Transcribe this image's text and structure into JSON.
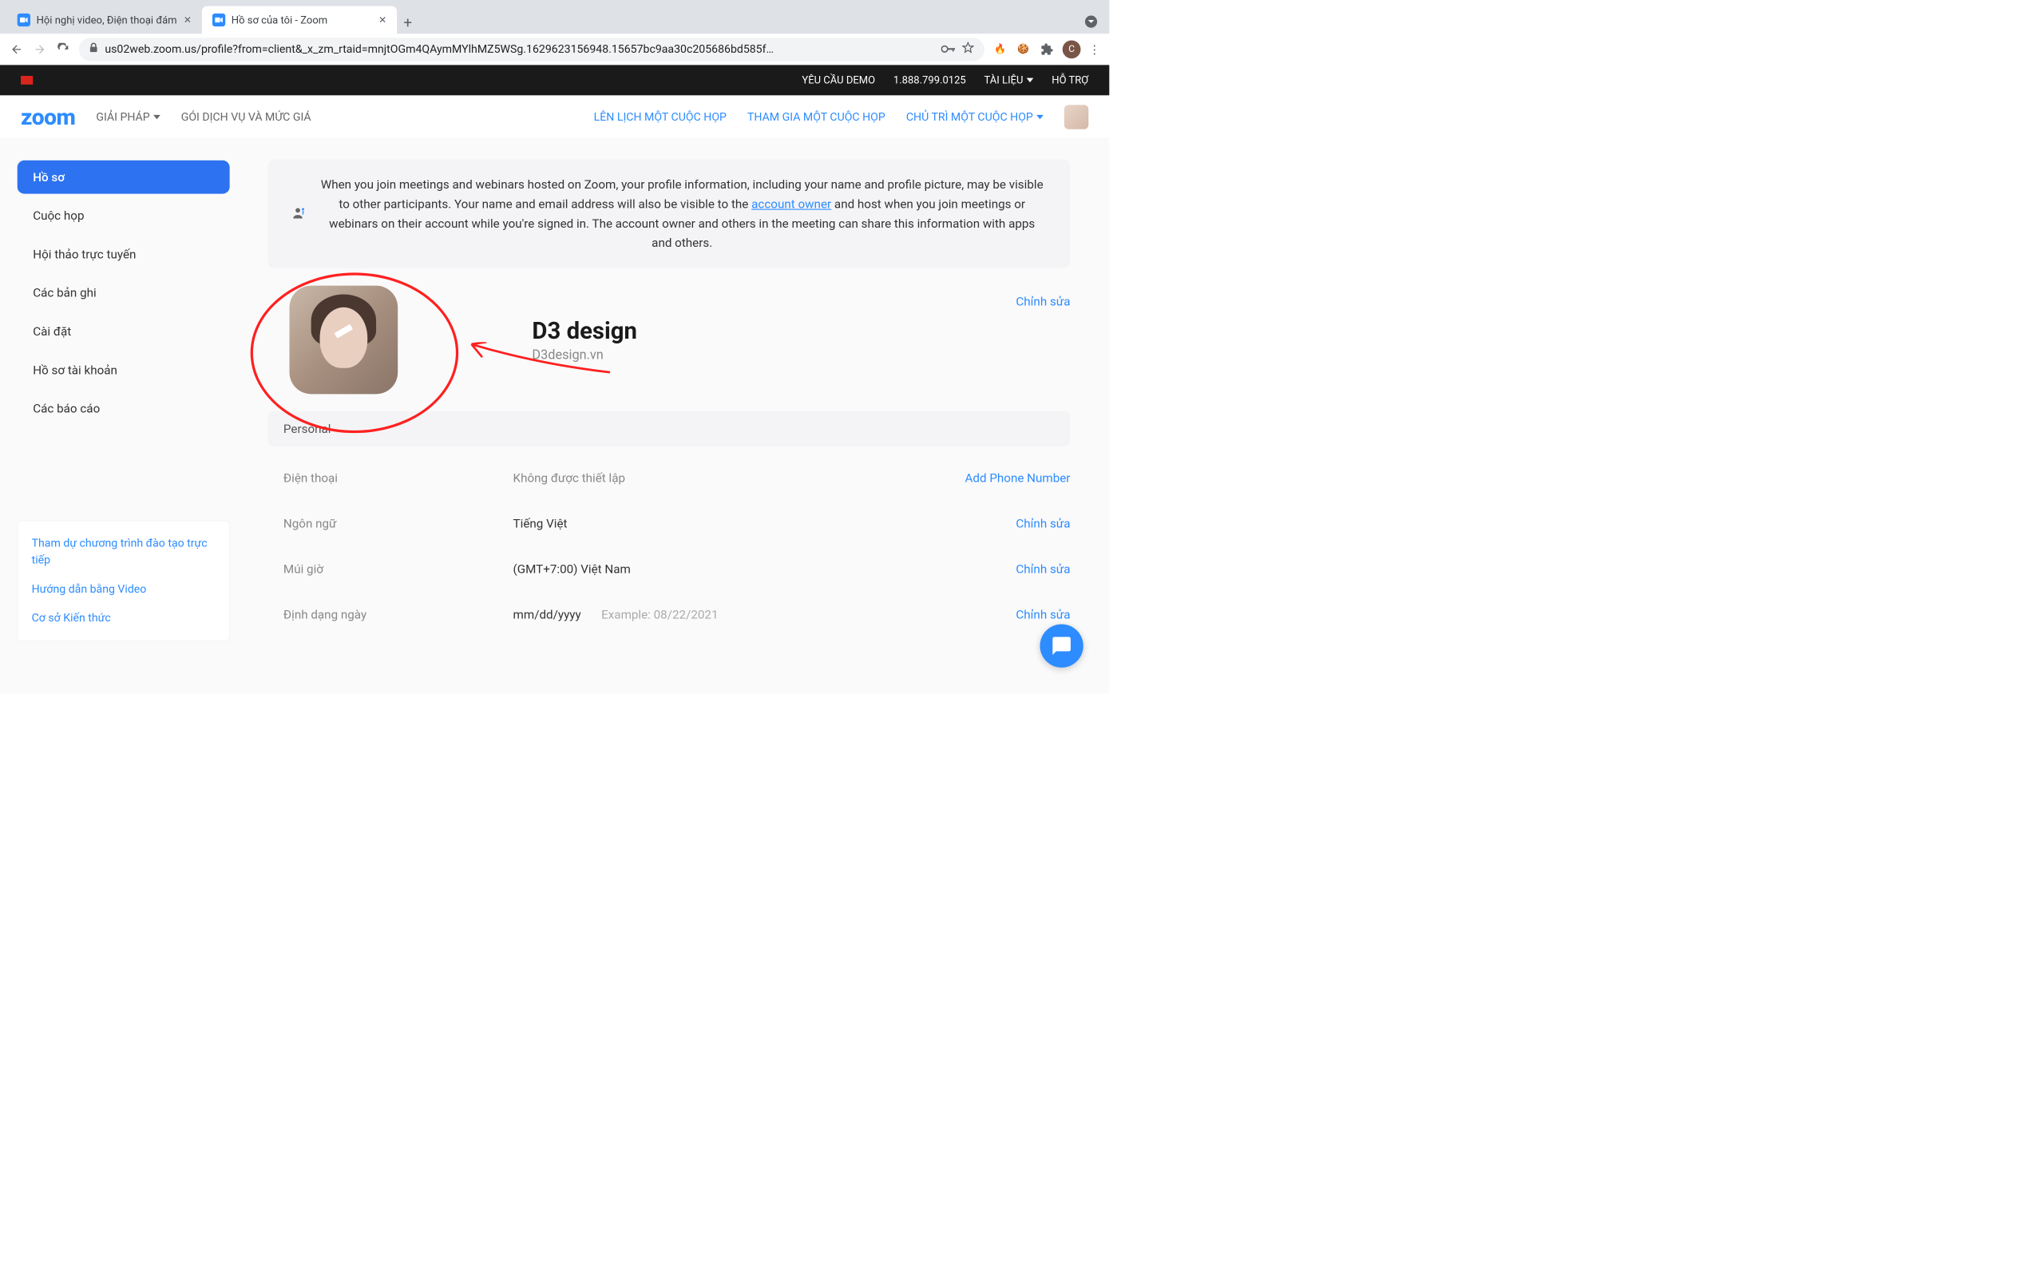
{
  "browser": {
    "tabs": [
      {
        "title": "Hội nghị video, Điện thoại đám"
      },
      {
        "title": "Hồ sơ của tôi - Zoom"
      }
    ],
    "url": "us02web.zoom.us/profile?from=client&_x_zm_rtaid=mnjtOGm4QAymMYlhMZ5WSg.1629623156948.15657bc9aa30c205686bd585f…",
    "avatar_letter": "C"
  },
  "topbar": {
    "demo": "YÊU CẦU DEMO",
    "phone": "1.888.799.0125",
    "resources": "TÀI LIỆU",
    "support": "HỖ TRỢ"
  },
  "header": {
    "logo": "zoom",
    "solutions": "GIẢI PHÁP",
    "plans": "GÓI DỊCH VỤ VÀ MỨC GIÁ",
    "schedule": "LÊN LỊCH MỘT CUỘC HỌP",
    "join": "THAM GIA MỘT CUỘC HỌP",
    "host": "CHỦ TRÌ MỘT CUỘC HỌP"
  },
  "sidebar": {
    "items": [
      "Hồ sơ",
      "Cuộc họp",
      "Hội thảo trực tuyến",
      "Các bản ghi",
      "Cài đặt",
      "Hồ sơ tài khoản",
      "Các báo cáo"
    ],
    "box": [
      "Tham dự chương trình đào tạo trực tiếp",
      "Hướng dẫn bằng Video",
      "Cơ sở Kiến thức"
    ]
  },
  "banner": {
    "text_pre": "When you join meetings and webinars hosted on Zoom, your profile information, including your name and profile picture, may be visible to other participants. Your name and email address will also be visible to the ",
    "link": "account owner",
    "text_post": " and host when you join meetings or webinars on their account while you're signed in. The account owner and others in the meeting can share this information with apps and others."
  },
  "profile": {
    "name": "D3 design",
    "subtitle": "D3design.vn",
    "edit": "Chỉnh sửa"
  },
  "section_personal": "Personal",
  "fields": {
    "phone": {
      "label": "Điện thoại",
      "value": "Không được thiết lập",
      "action": "Add Phone Number"
    },
    "language": {
      "label": "Ngôn ngữ",
      "value": "Tiếng Việt",
      "action": "Chỉnh sửa"
    },
    "timezone": {
      "label": "Múi giờ",
      "value": "(GMT+7:00) Việt Nam",
      "action": "Chỉnh sửa"
    },
    "dateformat": {
      "label": "Định dạng ngày",
      "value": "mm/dd/yyyy",
      "example": "Example: 08/22/2021",
      "action": "Chỉnh sửa"
    }
  }
}
